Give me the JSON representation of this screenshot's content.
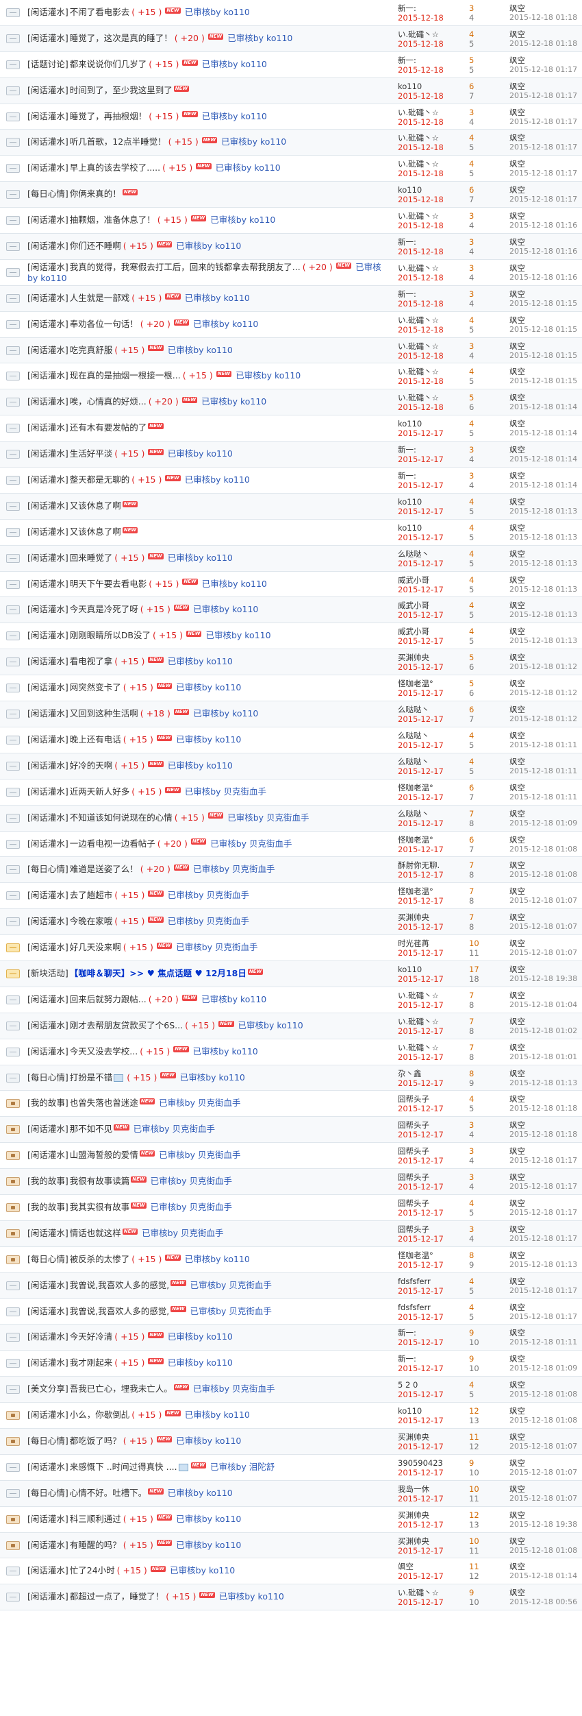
{
  "labels": {
    "new_badge": "NEW",
    "review_prefix": "已审核by"
  },
  "colors": {
    "reward": "#dd2222",
    "date": "#e0301e",
    "replies": "#d46a00",
    "review": "#2f5bb7",
    "new_badge": "#ee4444"
  },
  "threads": [
    {
      "cat": "[闲话灌水]",
      "title": "不闹了看电影去",
      "reward": "( +15 )",
      "reviewer": "ko110",
      "author": "新一:",
      "date": "2015-12-18",
      "replies": "3",
      "views": "4",
      "last_user": "飒空",
      "last_time": "2015-12-18 01:18",
      "icon": "normal"
    },
    {
      "cat": "[闲话灌水]",
      "title": "睡觉了，这次是真的睡了！",
      "reward": "( +20 )",
      "reviewer": "ko110",
      "author": "い.砒礵丶☆",
      "date": "2015-12-18",
      "replies": "4",
      "views": "5",
      "last_user": "飒空",
      "last_time": "2015-12-18 01:18",
      "icon": "normal"
    },
    {
      "cat": "[话题讨论]",
      "title": "都来说说你们几岁了",
      "reward": "( +15 )",
      "reviewer": "ko110",
      "author": "新一:",
      "date": "2015-12-18",
      "replies": "5",
      "views": "5",
      "last_user": "飒空",
      "last_time": "2015-12-18 01:17",
      "icon": "normal"
    },
    {
      "cat": "[闲话灌水]",
      "title": "时间到了，至少我这里到了",
      "reward": "",
      "reviewer": "",
      "author": "ko110",
      "date": "2015-12-18",
      "replies": "6",
      "views": "7",
      "last_user": "飒空",
      "last_time": "2015-12-18 01:17",
      "icon": "normal"
    },
    {
      "cat": "[闲话灌水]",
      "title": "睡觉了，再抽根烟！",
      "reward": "( +15 )",
      "reviewer": "ko110",
      "author": "い.砒礵丶☆",
      "date": "2015-12-18",
      "replies": "3",
      "views": "4",
      "last_user": "飒空",
      "last_time": "2015-12-18 01:17",
      "icon": "normal"
    },
    {
      "cat": "[闲话灌水]",
      "title": "听几首歌，12点半睡觉！",
      "reward": "( +15 )",
      "reviewer": "ko110",
      "author": "い.砒礵丶☆",
      "date": "2015-12-18",
      "replies": "4",
      "views": "5",
      "last_user": "飒空",
      "last_time": "2015-12-18 01:17",
      "icon": "normal"
    },
    {
      "cat": "[闲话灌水]",
      "title": "早上真的该去学校了.....",
      "reward": "( +15 )",
      "reviewer": "ko110",
      "author": "い.砒礵丶☆",
      "date": "2015-12-18",
      "replies": "4",
      "views": "5",
      "last_user": "飒空",
      "last_time": "2015-12-18 01:17",
      "icon": "normal"
    },
    {
      "cat": "[每日心情]",
      "title": "你俩来真的！",
      "reward": "",
      "reviewer": "",
      "author": "ko110",
      "date": "2015-12-18",
      "replies": "6",
      "views": "7",
      "last_user": "飒空",
      "last_time": "2015-12-18 01:17",
      "icon": "normal"
    },
    {
      "cat": "[闲话灌水]",
      "title": "抽颗烟，准备休息了！",
      "reward": "( +15 )",
      "reviewer": "ko110",
      "author": "い.砒礵丶☆",
      "date": "2015-12-18",
      "replies": "3",
      "views": "4",
      "last_user": "飒空",
      "last_time": "2015-12-18 01:16",
      "icon": "normal"
    },
    {
      "cat": "[闲话灌水]",
      "title": "你们还不睡啊",
      "reward": "( +15 )",
      "reviewer": "ko110",
      "author": "新一:",
      "date": "2015-12-18",
      "replies": "3",
      "views": "4",
      "last_user": "飒空",
      "last_time": "2015-12-18 01:16",
      "icon": "normal"
    },
    {
      "cat": "[闲话灌水]",
      "title": "我真的觉得，我寒假去打工后，回来的钱都拿去帮我朋友了...",
      "reward": "( +20 )",
      "reviewer": "ko110",
      "author": "い.砒礵丶☆",
      "date": "2015-12-18",
      "replies": "3",
      "views": "4",
      "last_user": "飒空",
      "last_time": "2015-12-18 01:16",
      "icon": "normal",
      "two_line": true
    },
    {
      "cat": "[闲话灌水]",
      "title": "人生就是一部戏",
      "reward": "( +15 )",
      "reviewer": "ko110",
      "author": "新一:",
      "date": "2015-12-18",
      "replies": "3",
      "views": "4",
      "last_user": "飒空",
      "last_time": "2015-12-18 01:15",
      "icon": "normal"
    },
    {
      "cat": "[闲话灌水]",
      "title": "奉劝各位一句话！",
      "reward": "( +20 )",
      "reviewer": "ko110",
      "author": "い.砒礵丶☆",
      "date": "2015-12-18",
      "replies": "4",
      "views": "5",
      "last_user": "飒空",
      "last_time": "2015-12-18 01:15",
      "icon": "normal"
    },
    {
      "cat": "[闲话灌水]",
      "title": "吃完真舒服",
      "reward": "( +15 )",
      "reviewer": "ko110",
      "author": "い.砒礵丶☆",
      "date": "2015-12-18",
      "replies": "3",
      "views": "4",
      "last_user": "飒空",
      "last_time": "2015-12-18 01:15",
      "icon": "normal"
    },
    {
      "cat": "[闲话灌水]",
      "title": "现在真的是抽烟一根接一根...",
      "reward": "( +15 )",
      "reviewer": "ko110",
      "author": "い.砒礵丶☆",
      "date": "2015-12-18",
      "replies": "4",
      "views": "5",
      "last_user": "飒空",
      "last_time": "2015-12-18 01:15",
      "icon": "normal"
    },
    {
      "cat": "[闲话灌水]",
      "title": "唉，心情真的好烦...",
      "reward": "( +20 )",
      "reviewer": "ko110",
      "author": "い.砒礵丶☆",
      "date": "2015-12-18",
      "replies": "5",
      "views": "6",
      "last_user": "飒空",
      "last_time": "2015-12-18 01:14",
      "icon": "normal"
    },
    {
      "cat": "[闲话灌水]",
      "title": "还有木有要发帖的了",
      "reward": "",
      "reviewer": "",
      "author": "ko110",
      "date": "2015-12-17",
      "replies": "4",
      "views": "5",
      "last_user": "飒空",
      "last_time": "2015-12-18 01:14",
      "icon": "normal"
    },
    {
      "cat": "[闲话灌水]",
      "title": "生活好平淡",
      "reward": "( +15 )",
      "reviewer": "ko110",
      "author": "新一:",
      "date": "2015-12-17",
      "replies": "3",
      "views": "4",
      "last_user": "飒空",
      "last_time": "2015-12-18 01:14",
      "icon": "normal"
    },
    {
      "cat": "[闲话灌水]",
      "title": "整天都是无聊的",
      "reward": "( +15 )",
      "reviewer": "ko110",
      "author": "新一:",
      "date": "2015-12-17",
      "replies": "3",
      "views": "4",
      "last_user": "飒空",
      "last_time": "2015-12-18 01:14",
      "icon": "normal"
    },
    {
      "cat": "[闲话灌水]",
      "title": "又该休息了啊",
      "reward": "",
      "reviewer": "",
      "author": "ko110",
      "date": "2015-12-17",
      "replies": "4",
      "views": "5",
      "last_user": "飒空",
      "last_time": "2015-12-18 01:13",
      "icon": "normal"
    },
    {
      "cat": "[闲话灌水]",
      "title": "又该休息了啊",
      "reward": "",
      "reviewer": "",
      "author": "ko110",
      "date": "2015-12-17",
      "replies": "4",
      "views": "5",
      "last_user": "飒空",
      "last_time": "2015-12-18 01:13",
      "icon": "normal"
    },
    {
      "cat": "[闲话灌水]",
      "title": "回来睡觉了",
      "reward": "( +15 )",
      "reviewer": "ko110",
      "author": "么哒哒丶",
      "date": "2015-12-17",
      "replies": "4",
      "views": "5",
      "last_user": "飒空",
      "last_time": "2015-12-18 01:13",
      "icon": "normal"
    },
    {
      "cat": "[闲话灌水]",
      "title": "明天下午要去看电影",
      "reward": "( +15 )",
      "reviewer": "ko110",
      "author": "威武小哥",
      "date": "2015-12-17",
      "replies": "4",
      "views": "5",
      "last_user": "飒空",
      "last_time": "2015-12-18 01:13",
      "icon": "normal"
    },
    {
      "cat": "[闲话灌水]",
      "title": "今天真是冷死了呀",
      "reward": "( +15 )",
      "reviewer": "ko110",
      "author": "威武小哥",
      "date": "2015-12-17",
      "replies": "4",
      "views": "5",
      "last_user": "飒空",
      "last_time": "2015-12-18 01:13",
      "icon": "normal"
    },
    {
      "cat": "[闲话灌水]",
      "title": "刚刚眼睛所以DB没了",
      "reward": "( +15 )",
      "reviewer": "ko110",
      "author": "威武小哥",
      "date": "2015-12-17",
      "replies": "4",
      "views": "5",
      "last_user": "飒空",
      "last_time": "2015-12-18 01:13",
      "icon": "normal"
    },
    {
      "cat": "[闲话灌水]",
      "title": "看电视了拿",
      "reward": "( +15 )",
      "reviewer": "ko110",
      "author": "买渊帅央",
      "date": "2015-12-17",
      "replies": "5",
      "views": "6",
      "last_user": "飒空",
      "last_time": "2015-12-18 01:12",
      "icon": "normal"
    },
    {
      "cat": "[闲话灌水]",
      "title": "网突然变卡了",
      "reward": "( +15 )",
      "reviewer": "ko110",
      "author": "怪咖老温°",
      "date": "2015-12-17",
      "replies": "5",
      "views": "6",
      "last_user": "飒空",
      "last_time": "2015-12-18 01:12",
      "icon": "normal"
    },
    {
      "cat": "[闲话灌水]",
      "title": "又回到这种生活啊",
      "reward": "( +18 )",
      "reviewer": "ko110",
      "author": "么哒哒丶",
      "date": "2015-12-17",
      "replies": "6",
      "views": "7",
      "last_user": "飒空",
      "last_time": "2015-12-18 01:12",
      "icon": "normal"
    },
    {
      "cat": "[闲话灌水]",
      "title": "晚上还有电话",
      "reward": "( +15 )",
      "reviewer": "ko110",
      "author": "么哒哒丶",
      "date": "2015-12-17",
      "replies": "4",
      "views": "5",
      "last_user": "飒空",
      "last_time": "2015-12-18 01:11",
      "icon": "normal"
    },
    {
      "cat": "[闲话灌水]",
      "title": "好冷的天啊",
      "reward": "( +15 )",
      "reviewer": "ko110",
      "author": "么哒哒丶",
      "date": "2015-12-17",
      "replies": "4",
      "views": "5",
      "last_user": "飒空",
      "last_time": "2015-12-18 01:11",
      "icon": "normal"
    },
    {
      "cat": "[闲话灌水]",
      "title": "近两天新人好多",
      "reward": "( +15 )",
      "reviewer": "贝克街血手",
      "author": "怪咖老温°",
      "date": "2015-12-17",
      "replies": "6",
      "views": "7",
      "last_user": "飒空",
      "last_time": "2015-12-18 01:11",
      "icon": "normal"
    },
    {
      "cat": "[闲话灌水]",
      "title": "不知道该如何说现在的心情",
      "reward": "( +15 )",
      "reviewer": "贝克街血手",
      "author": "么哒哒丶",
      "date": "2015-12-17",
      "replies": "7",
      "views": "8",
      "last_user": "飒空",
      "last_time": "2015-12-18 01:09",
      "icon": "normal"
    },
    {
      "cat": "[闲话灌水]",
      "title": "一边看电视一边看帖子",
      "reward": "( +20 )",
      "reviewer": "贝克街血手",
      "author": "怪咖老温°",
      "date": "2015-12-17",
      "replies": "6",
      "views": "7",
      "last_user": "飒空",
      "last_time": "2015-12-18 01:08",
      "icon": "normal"
    },
    {
      "cat": "[每日心情]",
      "title": "难道是送姿了么！",
      "reward": "( +20 )",
      "reviewer": "贝克街血手",
      "author": "酥射你无聊.",
      "date": "2015-12-17",
      "replies": "7",
      "views": "8",
      "last_user": "飒空",
      "last_time": "2015-12-18 01:08",
      "icon": "normal"
    },
    {
      "cat": "[闲话灌水]",
      "title": "去了趟超市",
      "reward": "( +15 )",
      "reviewer": "贝克街血手",
      "author": "怪咖老温°",
      "date": "2015-12-17",
      "replies": "7",
      "views": "8",
      "last_user": "飒空",
      "last_time": "2015-12-18 01:07",
      "icon": "normal"
    },
    {
      "cat": "[闲话灌水]",
      "title": "今晚在家哦",
      "reward": "( +15 )",
      "reviewer": "贝克街血手",
      "author": "买渊帅央",
      "date": "2015-12-17",
      "replies": "7",
      "views": "8",
      "last_user": "飒空",
      "last_time": "2015-12-18 01:07",
      "icon": "normal"
    },
    {
      "cat": "[闲话灌水]",
      "title": "好几天没来啊",
      "reward": "( +15 )",
      "reviewer": "贝克街血手",
      "author": "时光荏苒",
      "date": "2015-12-17",
      "replies": "10",
      "views": "11",
      "last_user": "飒空",
      "last_time": "2015-12-18 01:07",
      "icon": "hot"
    },
    {
      "cat": "[新块活动]",
      "title": "【咖啡＆聊天】>> ♥ 焦点话题 ♥ 12月18日",
      "reward": "",
      "reviewer": "",
      "author": "ko110",
      "date": "2015-12-17",
      "replies": "17",
      "views": "18",
      "last_user": "飒空",
      "last_time": "2015-12-18 19:38",
      "icon": "hot",
      "bold": true
    },
    {
      "cat": "[闲话灌水]",
      "title": "回来后就努力跟帖...",
      "reward": "( +20 )",
      "reviewer": "ko110",
      "author": "い.砒礵丶☆",
      "date": "2015-12-17",
      "replies": "7",
      "views": "8",
      "last_user": "飒空",
      "last_time": "2015-12-18 01:04",
      "icon": "normal"
    },
    {
      "cat": "[闲话灌水]",
      "title": "刚才去帮朋友贷款买了个6S...",
      "reward": "( +15 )",
      "reviewer": "ko110",
      "author": "い.砒礵丶☆",
      "date": "2015-12-17",
      "replies": "7",
      "views": "8",
      "last_user": "飒空",
      "last_time": "2015-12-18 01:02",
      "icon": "normal"
    },
    {
      "cat": "[闲话灌水]",
      "title": "今天又没去学校...",
      "reward": "( +15 )",
      "reviewer": "ko110",
      "author": "い.砒礵丶☆",
      "date": "2015-12-17",
      "replies": "7",
      "views": "8",
      "last_user": "飒空",
      "last_time": "2015-12-18 01:01",
      "icon": "normal"
    },
    {
      "cat": "[每日心情]",
      "title": "打扮是不错",
      "reward": "( +15 )",
      "reviewer": "ko110",
      "author": "尕丶鑫",
      "date": "2015-12-17",
      "replies": "8",
      "views": "9",
      "last_user": "飒空",
      "last_time": "2015-12-18 01:13",
      "icon": "normal",
      "has_image": true
    },
    {
      "cat": "[我的故事]",
      "title": "也曾失落也曾迷途",
      "reward": "",
      "reviewer": "贝克街血手",
      "author": "囧帮头子",
      "date": "2015-12-17",
      "replies": "4",
      "views": "5",
      "last_user": "飒空",
      "last_time": "2015-12-18 01:18",
      "icon": "lock"
    },
    {
      "cat": "[闲话灌水]",
      "title": "那不如不见",
      "reward": "",
      "reviewer": "贝克街血手",
      "author": "囧帮头子",
      "date": "2015-12-17",
      "replies": "3",
      "views": "4",
      "last_user": "飒空",
      "last_time": "2015-12-18 01:18",
      "icon": "lock"
    },
    {
      "cat": "[闲话灌水]",
      "title": "山盟海誓般的爱情",
      "reward": "",
      "reviewer": "贝克街血手",
      "author": "囧帮头子",
      "date": "2015-12-17",
      "replies": "3",
      "views": "4",
      "last_user": "飒空",
      "last_time": "2015-12-18 01:17",
      "icon": "lock"
    },
    {
      "cat": "[我的故事]",
      "title": "我很有故事读篇",
      "reward": "",
      "reviewer": "贝克街血手",
      "author": "囧帮头子",
      "date": "2015-12-17",
      "replies": "3",
      "views": "4",
      "last_user": "飒空",
      "last_time": "2015-12-18 01:17",
      "icon": "lock"
    },
    {
      "cat": "[我的故事]",
      "title": "我其实很有故事",
      "reward": "",
      "reviewer": "贝克街血手",
      "author": "囧帮头子",
      "date": "2015-12-17",
      "replies": "4",
      "views": "5",
      "last_user": "飒空",
      "last_time": "2015-12-18 01:17",
      "icon": "lock"
    },
    {
      "cat": "[闲话灌水]",
      "title": "情话也就这样",
      "reward": "",
      "reviewer": "贝克街血手",
      "author": "囧帮头子",
      "date": "2015-12-17",
      "replies": "3",
      "views": "4",
      "last_user": "飒空",
      "last_time": "2015-12-18 01:17",
      "icon": "lock"
    },
    {
      "cat": "[每日心情]",
      "title": "被反杀的太惨了",
      "reward": "( +15 )",
      "reviewer": "ko110",
      "author": "怪咖老温°",
      "date": "2015-12-17",
      "replies": "8",
      "views": "9",
      "last_user": "飒空",
      "last_time": "2015-12-18 01:13",
      "icon": "lock"
    },
    {
      "cat": "[闲话灌水]",
      "title": "我曾说,我喜欢人多的感觉,",
      "reward": "",
      "reviewer": "贝克街血手",
      "author": "fdsfsferr",
      "date": "2015-12-17",
      "replies": "4",
      "views": "5",
      "last_user": "飒空",
      "last_time": "2015-12-18 01:17",
      "icon": "normal"
    },
    {
      "cat": "[闲话灌水]",
      "title": "我曾说,我喜欢人多的感觉,",
      "reward": "",
      "reviewer": "贝克街血手",
      "author": "fdsfsferr",
      "date": "2015-12-17",
      "replies": "4",
      "views": "5",
      "last_user": "飒空",
      "last_time": "2015-12-18 01:17",
      "icon": "normal"
    },
    {
      "cat": "[闲话灌水]",
      "title": "今天好冷清",
      "reward": "( +15 )",
      "reviewer": "ko110",
      "author": "新一:",
      "date": "2015-12-17",
      "replies": "9",
      "views": "10",
      "last_user": "飒空",
      "last_time": "2015-12-18 01:11",
      "icon": "normal"
    },
    {
      "cat": "[闲话灌水]",
      "title": "我才刚起来",
      "reward": "( +15 )",
      "reviewer": "ko110",
      "author": "新一:",
      "date": "2015-12-17",
      "replies": "9",
      "views": "10",
      "last_user": "飒空",
      "last_time": "2015-12-18 01:09",
      "icon": "normal"
    },
    {
      "cat": "[美文分享]",
      "title": "吾我已亡心，埋我未亡人。",
      "reward": "",
      "reviewer": "贝克街血手",
      "author": "5 2 0",
      "date": "2015-12-17",
      "replies": "4",
      "views": "5",
      "last_user": "飒空",
      "last_time": "2015-12-18 01:08",
      "icon": "normal"
    },
    {
      "cat": "[闲话灌水]",
      "title": "小么，你歇倒乩",
      "reward": "( +15 )",
      "reviewer": "ko110",
      "author": "ko110",
      "date": "2015-12-17",
      "replies": "12",
      "views": "13",
      "last_user": "飒空",
      "last_time": "2015-12-18 01:08",
      "icon": "lock"
    },
    {
      "cat": "[每日心情]",
      "title": "都吃饭了吗？",
      "reward": "( +15 )",
      "reviewer": "ko110",
      "author": "买渊帅央",
      "date": "2015-12-17",
      "replies": "11",
      "views": "12",
      "last_user": "飒空",
      "last_time": "2015-12-18 01:07",
      "icon": "lock"
    },
    {
      "cat": "[闲话灌水]",
      "title": "来感慨下 ..时间过得真快 ....",
      "reward": "",
      "reviewer": "泪陀舒",
      "author": "390590423",
      "date": "2015-12-17",
      "replies": "9",
      "views": "10",
      "last_user": "飒空",
      "last_time": "2015-12-18 01:07",
      "icon": "normal",
      "has_image": true
    },
    {
      "cat": "[每日心情]",
      "title": "心情不好。吐槽下。",
      "reward": "",
      "reviewer": "ko110",
      "author": "我岛一休",
      "date": "2015-12-17",
      "replies": "10",
      "views": "11",
      "last_user": "飒空",
      "last_time": "2015-12-18 01:07",
      "icon": "normal"
    },
    {
      "cat": "[闲话灌水]",
      "title": "科三顺利通过",
      "reward": "( +15 )",
      "reviewer": "ko110",
      "author": "买渊帅央",
      "date": "2015-12-17",
      "replies": "12",
      "views": "13",
      "last_user": "飒空",
      "last_time": "2015-12-18 19:38",
      "icon": "lock"
    },
    {
      "cat": "[闲话灌水]",
      "title": "有睡醒的吗？",
      "reward": "( +15 )",
      "reviewer": "ko110",
      "author": "买渊帅央",
      "date": "2015-12-17",
      "replies": "10",
      "views": "11",
      "last_user": "飒空",
      "last_time": "2015-12-18 01:08",
      "icon": "lock"
    },
    {
      "cat": "[闲话灌水]",
      "title": "忙了24小时",
      "reward": "( +15 )",
      "reviewer": "ko110",
      "author": "飒空",
      "date": "2015-12-17",
      "replies": "11",
      "views": "12",
      "last_user": "飒空",
      "last_time": "2015-12-18 01:14",
      "icon": "normal"
    },
    {
      "cat": "[闲话灌水]",
      "title": "都超过一点了，睡觉了！",
      "reward": "( +15 )",
      "reviewer": "ko110",
      "author": "い.砒礵丶☆",
      "date": "2015-12-17",
      "replies": "9",
      "views": "10",
      "last_user": "飒空",
      "last_time": "2015-12-18 00:56",
      "icon": "normal"
    }
  ]
}
